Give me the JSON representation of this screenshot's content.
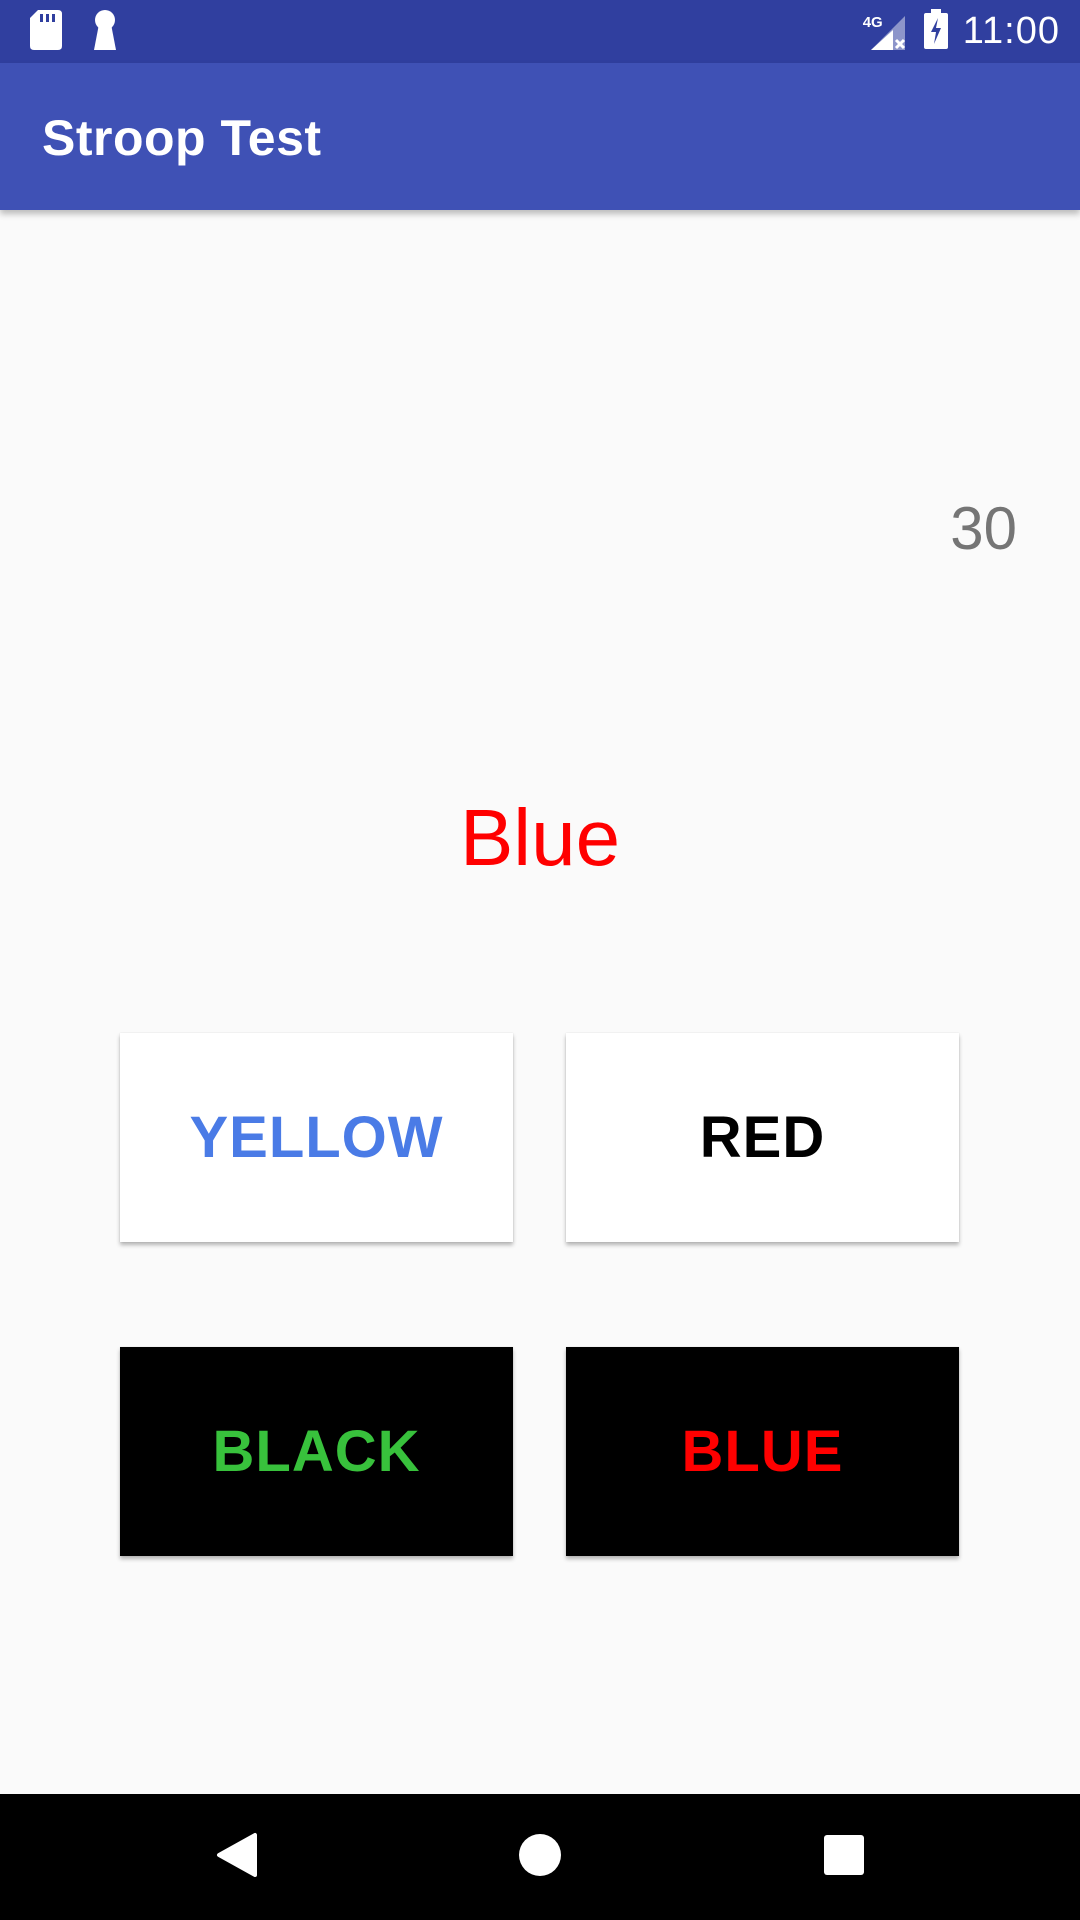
{
  "status_bar": {
    "network_type": "4G",
    "time": "11:00",
    "icons": [
      "sd-card-icon",
      "keyhole-icon",
      "signal-icon",
      "battery-charging-icon"
    ]
  },
  "app_bar": {
    "title": "Stroop Test"
  },
  "game": {
    "timer": "30",
    "stimulus_word": "Blue",
    "stimulus_color": "#ff0000",
    "buttons": [
      {
        "label": "YELLOW",
        "text_color": "#4a7be6",
        "background": "#ffffff"
      },
      {
        "label": "RED",
        "text_color": "#000000",
        "background": "#ffffff"
      },
      {
        "label": "BLACK",
        "text_color": "#38c13c",
        "background": "#000000"
      },
      {
        "label": "BLUE",
        "text_color": "#ff0000",
        "background": "#000000"
      }
    ]
  },
  "nav_bar": {
    "buttons": [
      "back-icon",
      "home-icon",
      "recents-icon"
    ]
  },
  "colors": {
    "status_bar": "#303f9f",
    "app_bar": "#3f51b5",
    "background": "#fafafa",
    "timer_text": "#757575"
  }
}
